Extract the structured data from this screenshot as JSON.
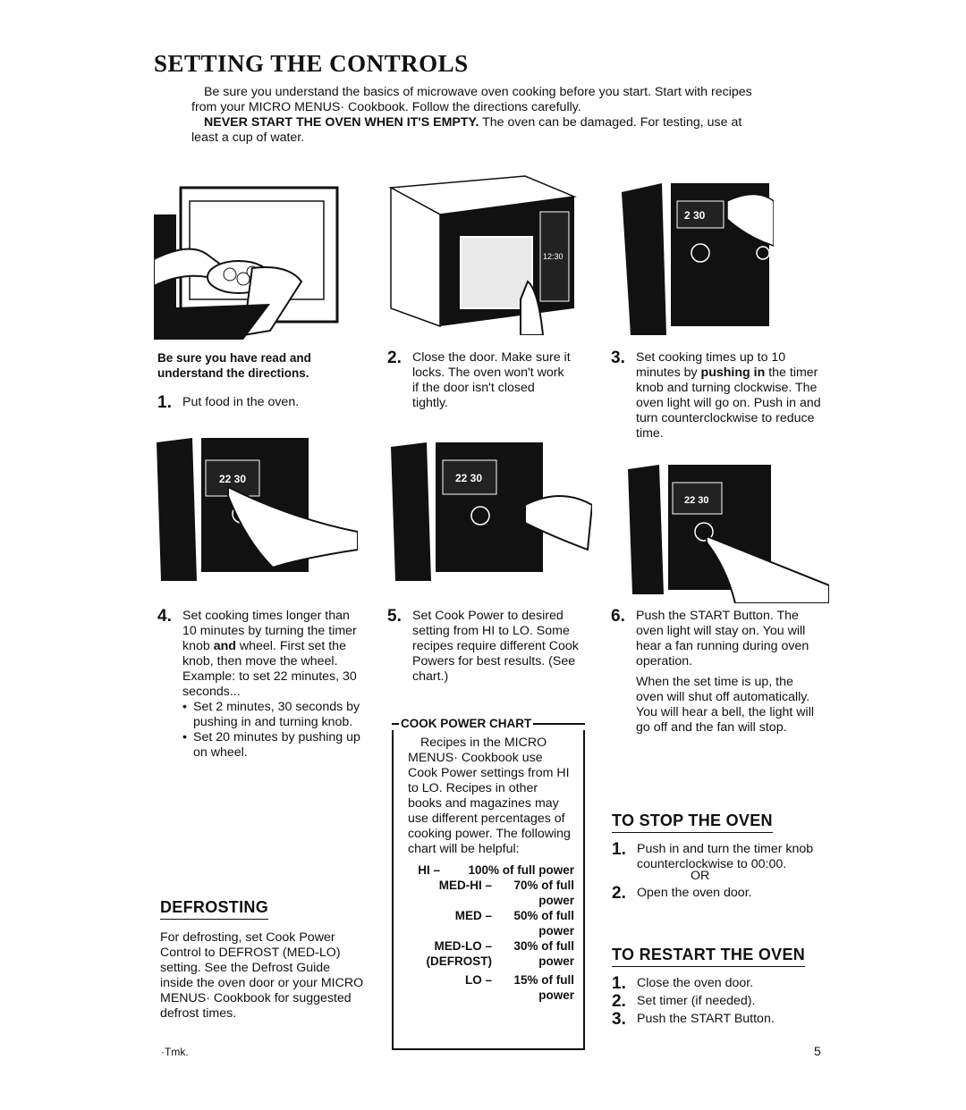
{
  "page": {
    "title": "SETTING THE CONTROLS",
    "intro_p1": "Be sure you understand the basics of microwave oven cooking before you start. Start with recipes from your  MICRO MENUS· Cookbook.  Follow the directions carefully.",
    "intro_p2_bold": "NEVER START THE OVEN WHEN IT'S EMPTY.",
    "intro_p2_rest": " The oven can be damaged. For testing, use at least a cup of water.",
    "page_number": "5",
    "footnote": "·Tmk."
  },
  "steps": [
    {
      "number": "1.",
      "pre_bold": "Be sure you have read and understand the directions.",
      "text": "Put food in the oven."
    },
    {
      "number": "2.",
      "text": "Close the door. Make sure it locks. The oven won't work if the door isn't closed tightly."
    },
    {
      "number": "3.",
      "text_a": "Set cooking times up to 10 minutes by ",
      "bold": "pushing in",
      "text_b": " the timer knob and turning clockwise. The oven light will go on. Push in and turn counterclockwise to reduce time."
    },
    {
      "number": "4.",
      "text_a": "Set cooking times longer than 10 minutes by turning the timer knob ",
      "bold": "and",
      "text_b": " wheel. First set the knob, then move the wheel. Example: to set 22 minutes, 30 seconds...",
      "bullets": [
        "Set 2 minutes, 30 seconds by pushing in and turning knob.",
        "Set 20 minutes by pushing up on wheel."
      ]
    },
    {
      "number": "5.",
      "text": "Set Cook Power to desired setting from HI to LO. Some recipes require different Cook Powers for best results. (See chart.)"
    },
    {
      "number": "6.",
      "text": "Push the START Button. The oven light will stay on. You will hear a fan running during oven operation.",
      "text2": "When the set time is up, the oven will shut off automatically. You will hear a bell, the light will go off and the fan will stop."
    }
  ],
  "cook_power_chart": {
    "heading": "COOK POWER CHART",
    "intro": "Recipes in the MICRO MENUS· Cookbook  use Cook Power settings from HI to LO. Recipes in other books and magazines may use different percentages of cooking power. The following chart will be helpful:",
    "rows": [
      {
        "label": "HI –",
        "value": "100% of full power"
      },
      {
        "label": "MED-HI –",
        "value": "70% of full power"
      },
      {
        "label": "MED –",
        "value": "50% of full power"
      },
      {
        "label": "MED-LO – (DEFROST)",
        "value": "30% of full power"
      },
      {
        "label": "LO –",
        "value": "15% of full power"
      }
    ]
  },
  "defrosting": {
    "heading": "DEFROSTING",
    "text": "For defrosting, set Cook Power Control to DEFROST (MED-LO) setting. See the Defrost Guide inside the oven door or your  MICRO MENUS· Cookbook  for suggested defrost times."
  },
  "stop_oven": {
    "heading": "TO STOP THE OVEN",
    "items": [
      {
        "number": "1.",
        "text": "Push in and turn the timer knob counterclockwise to 00:00."
      },
      {
        "number": "2.",
        "text": "Open the oven door."
      }
    ],
    "or": "OR"
  },
  "restart_oven": {
    "heading": "TO RESTART THE OVEN",
    "items": [
      {
        "number": "1.",
        "text": "Close the oven door."
      },
      {
        "number": "2.",
        "text": "Set timer (if needed)."
      },
      {
        "number": "3.",
        "text": "Push the START Button."
      }
    ]
  },
  "illustrations": {
    "fig1": "hands-placing-bowl-in-oven",
    "fig2": "hand-closing-oven-door",
    "fig2_display": "12:30",
    "fig3": "hand-turning-timer-knob",
    "fig3_display": "2 30",
    "fig4": "hand-pushing-timer-wheel",
    "fig4_display": "22 30",
    "fig5": "hand-setting-cook-power",
    "fig5_display": "22 30",
    "fig6": "finger-pushing-start-button",
    "fig6_display": "22 30"
  }
}
